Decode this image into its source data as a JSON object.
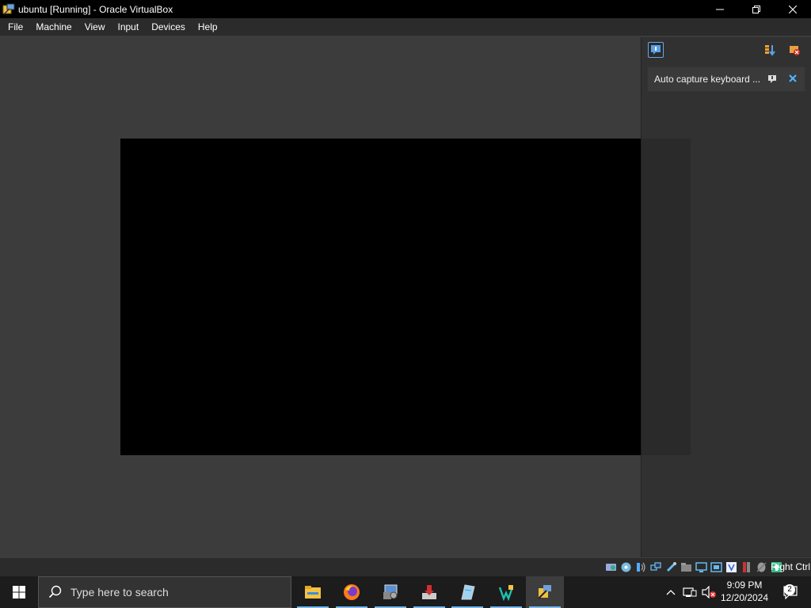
{
  "window": {
    "title": "ubuntu [Running] - Oracle VirtualBox",
    "controls": [
      "minimize",
      "restore",
      "close"
    ]
  },
  "menu": {
    "items": [
      "File",
      "Machine",
      "View",
      "Input",
      "Devices",
      "Help"
    ]
  },
  "vm": {
    "screen_color": "#000000"
  },
  "notifications": {
    "items": [
      {
        "text": "Auto capture keyboard ..."
      }
    ]
  },
  "statusbar": {
    "host_key": "Right Ctrl",
    "icons": [
      "hard-disk-icon",
      "optical-drive-icon",
      "audio-icon",
      "network-icon",
      "usb-icon",
      "shared-folders-icon",
      "display-icon",
      "recording-icon",
      "vt-x-icon",
      "cpu-icon",
      "mouse-integration-icon",
      "host-key-icon"
    ]
  },
  "taskbar": {
    "search_placeholder": "Type here to search",
    "apps": [
      "file-explorer-icon",
      "firefox-icon",
      "control-panel-icon",
      "installer-icon",
      "notepad-icon",
      "vscode-icon",
      "virtualbox-icon"
    ],
    "clock_time": "9:09 PM",
    "clock_date": "12/20/2024",
    "notification_count": "2"
  },
  "colors": {
    "accent": "#76b9ed",
    "notif_close": "#4fb5ff",
    "background": "#3c3c3c"
  }
}
